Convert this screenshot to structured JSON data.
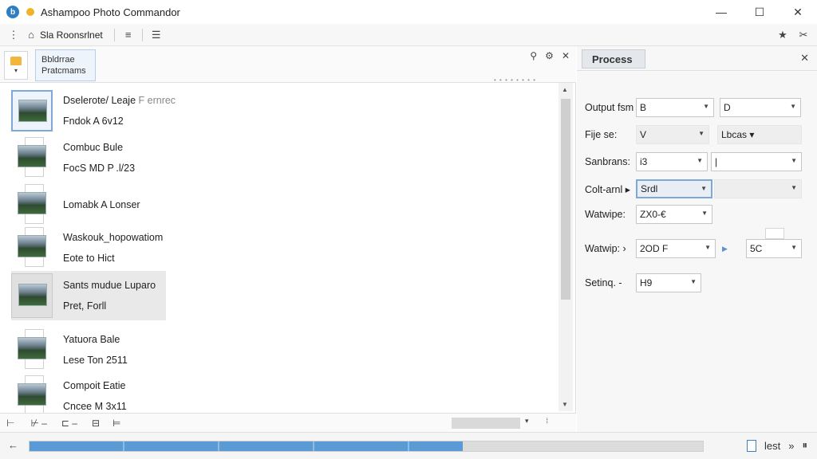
{
  "window": {
    "title": "Ashampoo Photo Commandor",
    "logo_glyph": "b",
    "minimize_glyph": "—",
    "maximize_glyph": "☐",
    "close_glyph": "✕"
  },
  "toolbar": {
    "label": "Sla Roonsrlnet",
    "icons": [
      "home-icon",
      "align-icon",
      "list-icon",
      "pin-icon",
      "tools-icon"
    ],
    "home_glyph": "⌂",
    "align_glyph": "≡",
    "list_glyph": "☰",
    "pin_glyph": "★",
    "tools_glyph": "✂"
  },
  "left_header": {
    "tab_line1": "Bbldrrae",
    "tab_line2": "Pratcmams",
    "chevron": "▾",
    "filter_glyph": "⚲",
    "settings_glyph": "⚙",
    "close_glyph": "✕",
    "dots": "• • • • • • • •"
  },
  "files": [
    {
      "line1": "Dselerote/ Leaje",
      "line1_extra": "F ernrec",
      "line2": "Fndok A 6v12"
    },
    {
      "line1": "Combuc Bule",
      "line1_extra": "",
      "line2": "FocS MD P .l/23"
    },
    {
      "line1": "Lomabk A Lonser",
      "line1_extra": "",
      "line2": ""
    },
    {
      "line1": "Waskouk_hopowatiom",
      "line1_extra": "",
      "line2": "Eote to Hict"
    },
    {
      "line1": "Sants mudue Luparo",
      "line1_extra": "",
      "line2": "Pret, Forll"
    },
    {
      "line1": "Yatuora Bale",
      "line1_extra": "",
      "line2": "Lese Ton 2511"
    },
    {
      "line1": "Compoit Eatie",
      "line1_extra": "",
      "line2": "Cncee M 3x11"
    }
  ],
  "list_bottom": {
    "glyphs": [
      "⊢",
      "⊬ –",
      "⊏ –",
      "⊟",
      "⊨"
    ],
    "dropdown_glyph": "▾",
    "more_glyph": "⁞"
  },
  "process": {
    "tab_label": "Process",
    "close_glyph": "✕",
    "rows": [
      {
        "label": "Output fsm",
        "value1": "B",
        "value2": "D"
      },
      {
        "label": "Fije se:",
        "value1": "V",
        "value2": "Lbcas ▾"
      },
      {
        "label": "Sanbrans:",
        "value1": "i3",
        "value2": "|"
      },
      {
        "label": "Colt-arnl ▸",
        "value1": "Srdl",
        "value2": ""
      },
      {
        "label": "Watwipe:",
        "value1": "ZX0-€",
        "value2": ""
      },
      {
        "label": "Watwip: ›",
        "value1": "2OD F",
        "value2": "5C"
      },
      {
        "label": "Setinq. -",
        "value1": "H9",
        "value2": ""
      }
    ]
  },
  "status": {
    "back_glyph": "←",
    "progress_fraction": 0.643,
    "last_label": "lest",
    "forward_glyph": "»",
    "pause_glyph": "⏸"
  }
}
